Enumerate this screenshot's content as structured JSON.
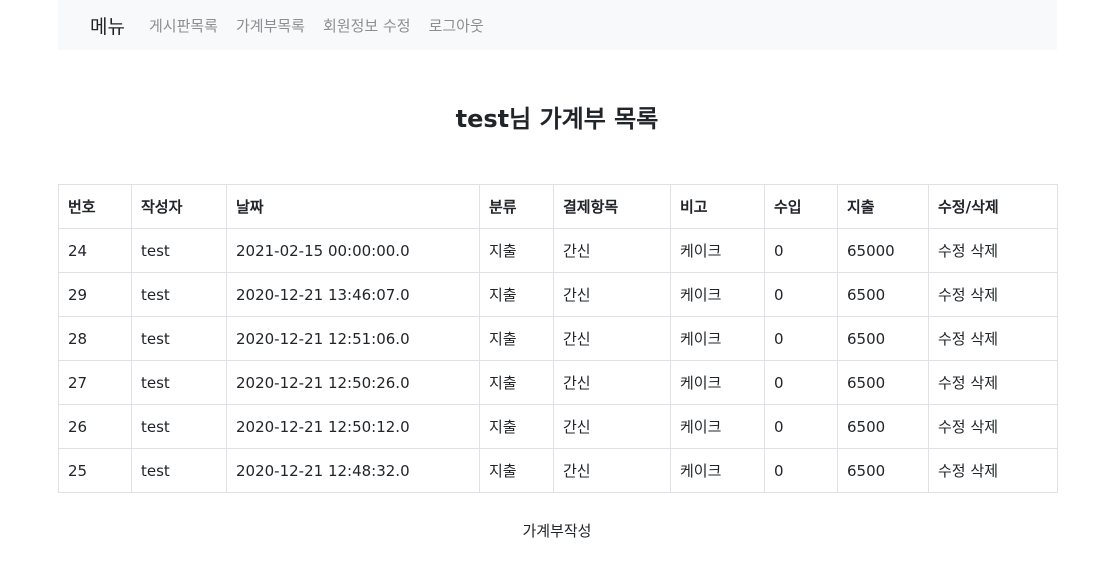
{
  "nav": {
    "brand": "메뉴",
    "links": [
      "게시판목록",
      "가계부목록",
      "회원정보 수정",
      "로그아웃"
    ]
  },
  "page_title": "test님 가계부 목록",
  "table": {
    "headers": [
      "번호",
      "작성자",
      "날짜",
      "분류",
      "결제항목",
      "비고",
      "수입",
      "지출",
      "수정/삭제"
    ],
    "rows": [
      {
        "no": "24",
        "writer": "test",
        "date": "2021-02-15 00:00:00.0",
        "type": "지출",
        "item": "간신",
        "memo": "케이크",
        "income": "0",
        "expense": "65000",
        "edit": "수정",
        "delete": "삭제"
      },
      {
        "no": "29",
        "writer": "test",
        "date": "2020-12-21 13:46:07.0",
        "type": "지출",
        "item": "간신",
        "memo": "케이크",
        "income": "0",
        "expense": "6500",
        "edit": "수정",
        "delete": "삭제"
      },
      {
        "no": "28",
        "writer": "test",
        "date": "2020-12-21 12:51:06.0",
        "type": "지출",
        "item": "간신",
        "memo": "케이크",
        "income": "0",
        "expense": "6500",
        "edit": "수정",
        "delete": "삭제"
      },
      {
        "no": "27",
        "writer": "test",
        "date": "2020-12-21 12:50:26.0",
        "type": "지출",
        "item": "간신",
        "memo": "케이크",
        "income": "0",
        "expense": "6500",
        "edit": "수정",
        "delete": "삭제"
      },
      {
        "no": "26",
        "writer": "test",
        "date": "2020-12-21 12:50:12.0",
        "type": "지출",
        "item": "간신",
        "memo": "케이크",
        "income": "0",
        "expense": "6500",
        "edit": "수정",
        "delete": "삭제"
      },
      {
        "no": "25",
        "writer": "test",
        "date": "2020-12-21 12:48:32.0",
        "type": "지출",
        "item": "간신",
        "memo": "케이크",
        "income": "0",
        "expense": "6500",
        "edit": "수정",
        "delete": "삭제"
      }
    ]
  },
  "write_link": "가계부작성"
}
